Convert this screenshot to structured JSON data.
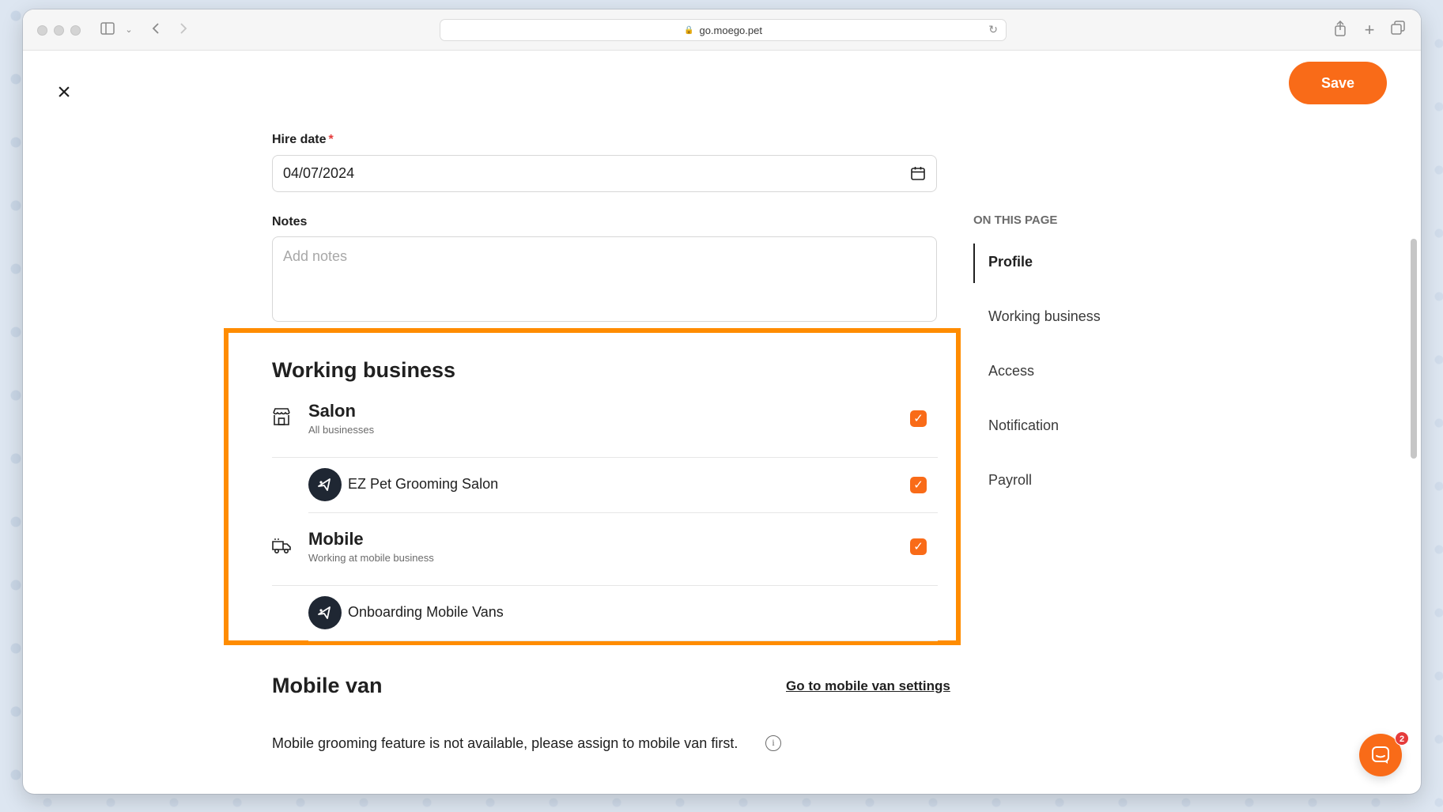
{
  "browser": {
    "url": "go.moego.pet"
  },
  "header": {
    "save_label": "Save"
  },
  "form": {
    "hire_date_label": "Hire date",
    "hire_date_required_mark": "*",
    "hire_date_value": "04/07/2024",
    "notes_label": "Notes",
    "notes_placeholder": "Add notes"
  },
  "working_business": {
    "title": "Working business",
    "groups": [
      {
        "title": "Salon",
        "subtitle": "All businesses",
        "checked": true,
        "icon": "storefront-icon",
        "businesses": [
          {
            "name": "EZ Pet Grooming Salon",
            "checked": true
          }
        ]
      },
      {
        "title": "Mobile",
        "subtitle": "Working at mobile business",
        "checked": true,
        "icon": "van-icon",
        "businesses": [
          {
            "name": "Onboarding Mobile Vans",
            "checked": false
          }
        ]
      }
    ],
    "highlight_color": "#ff8c00"
  },
  "mobile_van": {
    "title": "Mobile van",
    "link_label": "Go to mobile van settings",
    "info_text": "Mobile grooming feature is not available, please assign to mobile van first."
  },
  "toc": {
    "heading": "ON THIS PAGE",
    "items": [
      {
        "label": "Profile",
        "active": true
      },
      {
        "label": "Working business",
        "active": false
      },
      {
        "label": "Access",
        "active": false
      },
      {
        "label": "Notification",
        "active": false
      },
      {
        "label": "Payroll",
        "active": false
      }
    ]
  },
  "chat": {
    "badge_count": "2"
  },
  "colors": {
    "accent": "#f96b18",
    "required": "#e53b3b",
    "text": "#202020"
  }
}
